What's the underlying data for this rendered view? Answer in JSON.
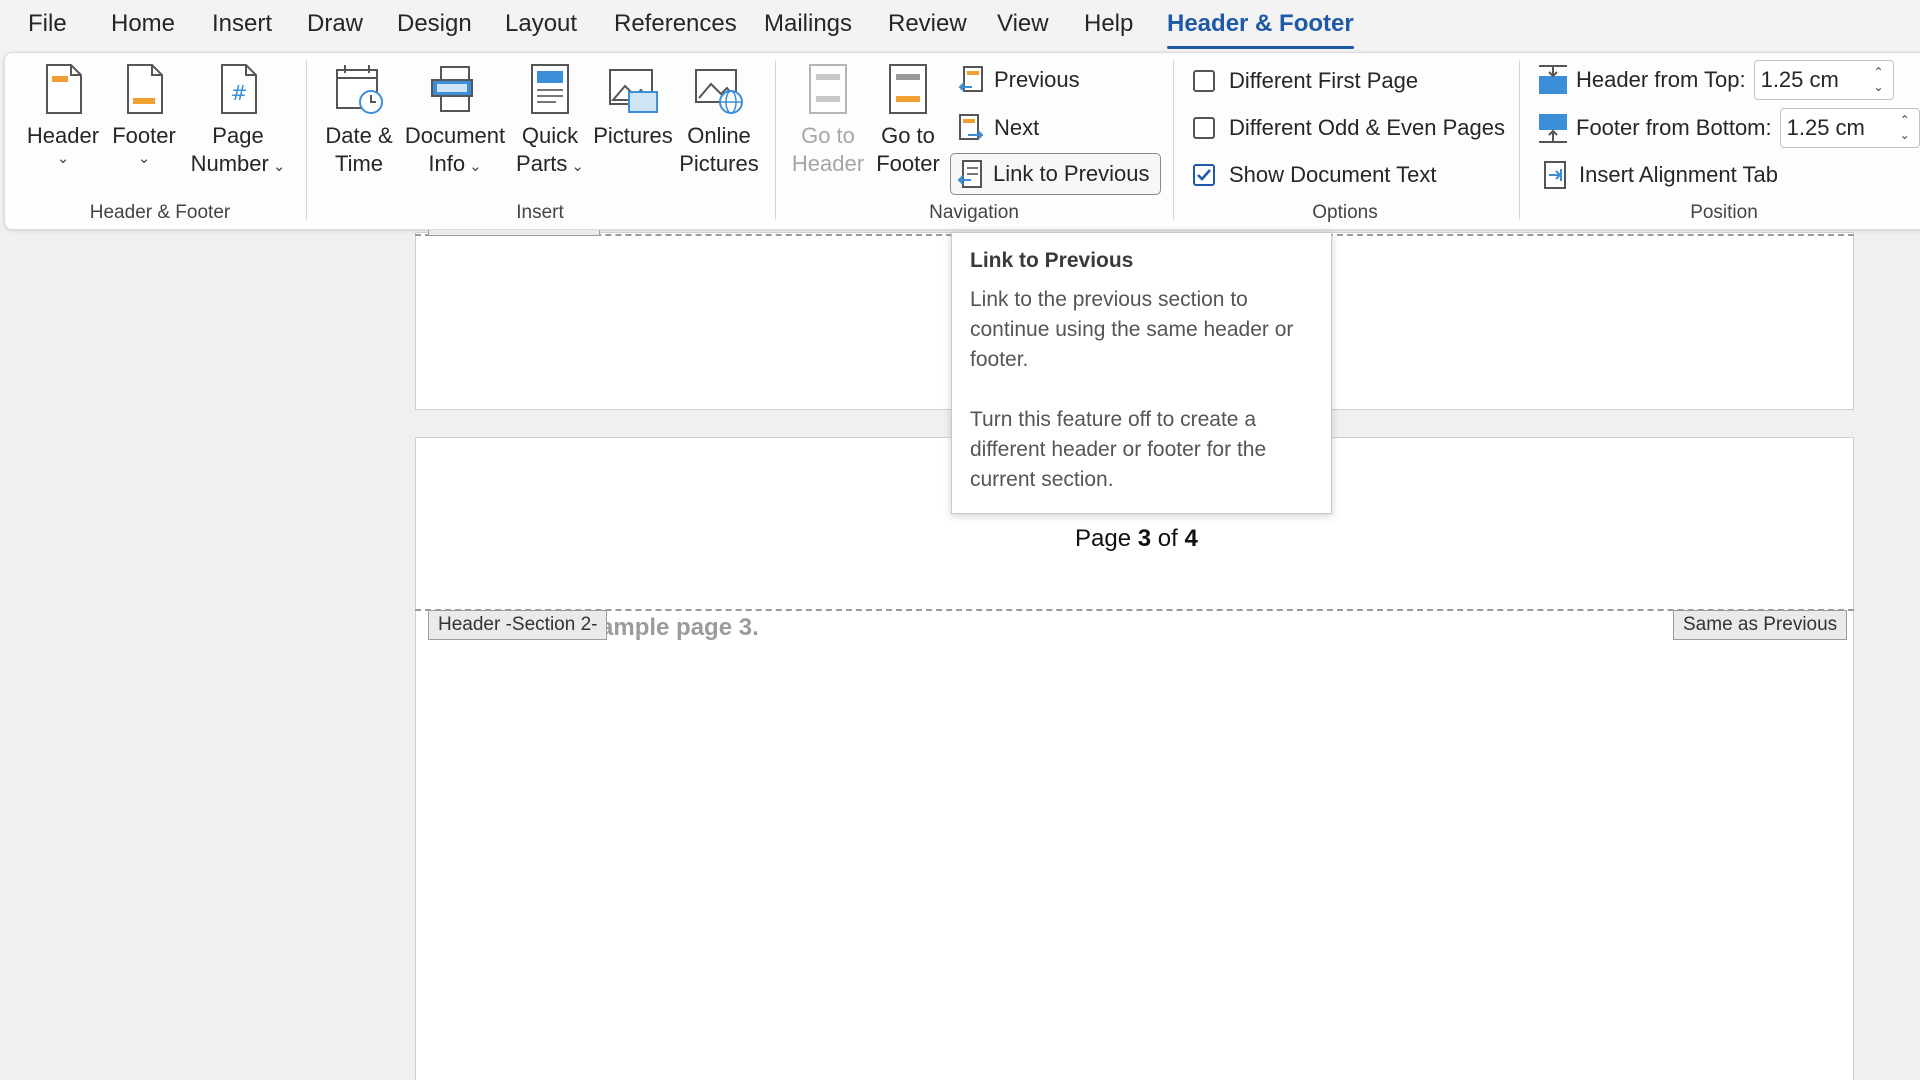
{
  "menu": {
    "tabs": [
      "File",
      "Home",
      "Insert",
      "Draw",
      "Design",
      "Layout",
      "References",
      "Mailings",
      "Review",
      "View",
      "Help",
      "Header & Footer"
    ],
    "active": "Header & Footer"
  },
  "ribbon": {
    "header_footer_group": {
      "label": "Header & Footer",
      "header": "Header",
      "footer": "Footer",
      "page_number_line1": "Page",
      "page_number_line2": "Number"
    },
    "insert_group": {
      "label": "Insert",
      "date_time_line1": "Date &",
      "date_time_line2": "Time",
      "document_info_line1": "Document",
      "document_info_line2": "Info",
      "quick_parts_line1": "Quick",
      "quick_parts_line2": "Parts",
      "pictures": "Pictures",
      "online_pictures_line1": "Online",
      "online_pictures_line2": "Pictures"
    },
    "navigation_group": {
      "label": "Navigation",
      "go_to_header_line1": "Go to",
      "go_to_header_line2": "Header",
      "go_to_footer_line1": "Go to",
      "go_to_footer_line2": "Footer",
      "previous": "Previous",
      "next": "Next",
      "link_to_previous": "Link to Previous"
    },
    "options_group": {
      "label": "Options",
      "different_first_page": "Different First Page",
      "different_odd_even": "Different Odd & Even Pages",
      "show_document_text": "Show Document Text"
    },
    "position_group": {
      "label": "Position",
      "header_from_top_label": "Header from Top:",
      "header_from_top_value": "1.25 cm",
      "footer_from_bottom_label": "Footer from Bottom:",
      "footer_from_bottom_value": "1.25 cm",
      "insert_alignment_tab": "Insert Alignment Tab"
    }
  },
  "tooltip": {
    "title": "Link to Previous",
    "paragraph1": "Link to the previous section to continue using the same header or footer.",
    "paragraph2": "Turn this feature off to create a different header or footer for the current section."
  },
  "document": {
    "footer_page_prefix": "Page ",
    "footer_page_current": "3",
    "footer_page_of": " of ",
    "footer_page_total": "4",
    "header_tag": "Header -Section 2-",
    "same_as_previous": "Same as Previous",
    "body_text_fragment": "ample page 3."
  },
  "colors": {
    "accent": "#1e5aa8",
    "icon_orange": "#f0a030",
    "icon_blue": "#3b8ed8"
  }
}
